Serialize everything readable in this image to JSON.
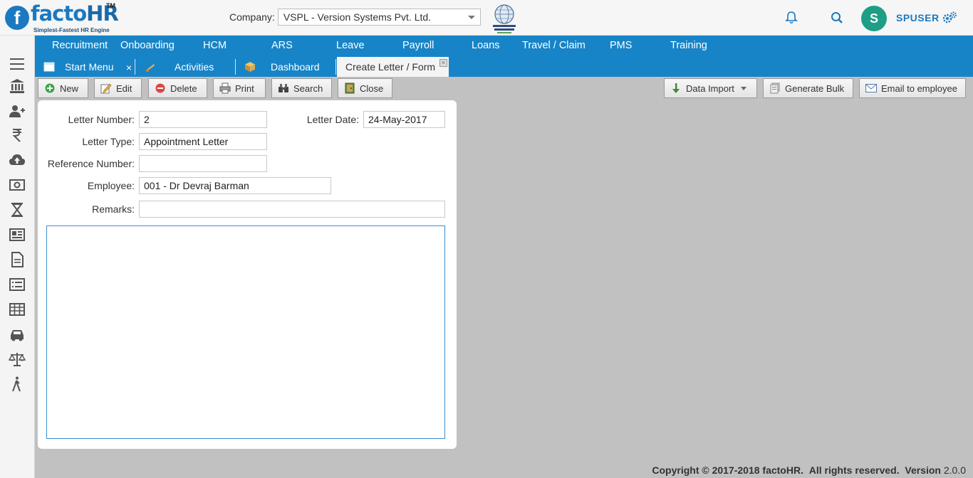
{
  "app": {
    "logo_word": "facto",
    "logo_word_hr": "HR",
    "logo_tm": "TM",
    "logo_tagline": "Simplest-Fastest HR Engine",
    "company_label": "Company:",
    "company_value": "VSPL - Version Systems Pvt. Ltd.",
    "username": "SPUSER",
    "avatar_letter": "S"
  },
  "nav": [
    "Recruitment",
    "Onboarding",
    "HCM",
    "ARS",
    "Leave",
    "Payroll",
    "Loans",
    "Travel / Claim",
    "PMS",
    "Training"
  ],
  "tabs": {
    "start_menu": "Start Menu",
    "activities": "Activities",
    "dashboard": "Dashboard",
    "create_letter": "Create Letter / Form",
    "close_glyph": "×"
  },
  "toolbar": {
    "new": "New",
    "edit": "Edit",
    "delete": "Delete",
    "print": "Print",
    "search": "Search",
    "close": "Close",
    "data_import": "Data Import",
    "generate_bulk": "Generate Bulk",
    "email_to_employee": "Email to employee"
  },
  "form": {
    "letter_number_label": "Letter Number:",
    "letter_number": "2",
    "letter_date_label": "Letter Date:",
    "letter_date": "24-May-2017",
    "letter_type_label": "Letter Type:",
    "letter_type": "Appointment Letter",
    "reference_number_label": "Reference Number:",
    "reference_number": "",
    "employee_label": "Employee:",
    "employee": "001 - Dr Devraj Barman",
    "remarks_label": "Remarks:",
    "remarks": ""
  },
  "footer": {
    "copyright": "Copyright © 2017-2018 factoHR.",
    "rights": "All rights reserved.",
    "version_label": "Version",
    "version": "2.0.0"
  },
  "colors": {
    "nav_blue": "#1784c7",
    "brand_blue": "#1b79c1",
    "avatar_green": "#1e9e85"
  }
}
